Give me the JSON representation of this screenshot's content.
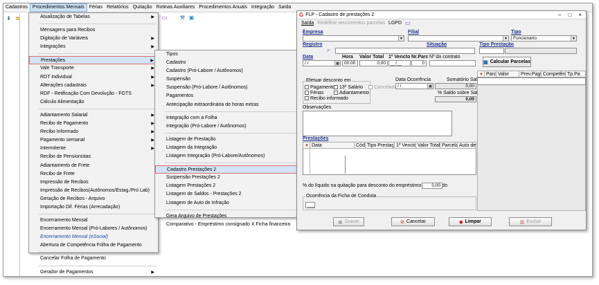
{
  "menubar": [
    "Cadastros",
    "Procedimentos Mensais",
    "Férias",
    "Relatórios",
    "Quitação",
    "Rotinas Auxiliares",
    "Procedimentos Anuais",
    "Integração",
    "Saída"
  ],
  "menu1": [
    {
      "label": "Atualização de Tabelas",
      "arrow": true
    },
    {
      "sep": true
    },
    {
      "label": "Mensagens para Recibos"
    },
    {
      "label": "Digitação de Variáveis",
      "arrow": true
    },
    {
      "label": "Integrações",
      "arrow": true
    },
    {
      "sep": true
    },
    {
      "label": "Prestações",
      "arrow": true,
      "selected": true
    },
    {
      "label": "Vale Transporte",
      "arrow": true
    },
    {
      "label": "RDT Individual",
      "arrow": true
    },
    {
      "label": "Alterações cadastrais",
      "arrow": true
    },
    {
      "label": "RDF - Retificação Com Devolução - FGTS"
    },
    {
      "label": "Cálculo Alimentação"
    },
    {
      "sep": true
    },
    {
      "label": "Adiantamento Salarial",
      "arrow": true
    },
    {
      "label": "Recibo de Pagamento",
      "arrow": true
    },
    {
      "label": "Recibo Informado",
      "arrow": true
    },
    {
      "label": "Pagamento semanal",
      "arrow": true
    },
    {
      "label": "Intermitente",
      "arrow": true
    },
    {
      "label": "Recibo de Pensionistas"
    },
    {
      "label": "Adiantamento de Frete"
    },
    {
      "label": "Recibo de Frete"
    },
    {
      "label": "Impressão de Recibos"
    },
    {
      "label": "Impressão de Recibos(Autônomos/Estag./Pró Lab)"
    },
    {
      "label": "Geração de Recibos - Arquivo"
    },
    {
      "label": "Importação Dif. Férias (Arrecadação)"
    },
    {
      "sep": true
    },
    {
      "label": "Encerramento Mensal"
    },
    {
      "label": "Encerramento Mensal (Pró-Labores / Autônomos)"
    },
    {
      "label": "Encerramento Mensal (eSocial)",
      "blue": true
    },
    {
      "label": "Abertura de Competência Folha de Pagamento"
    },
    {
      "sep": true
    },
    {
      "label": "Cancelar Folha de Pagamento"
    },
    {
      "sep": true
    },
    {
      "label": "Gerador de Pagamentos",
      "arrow": true
    }
  ],
  "menu2": [
    {
      "label": "Tipos"
    },
    {
      "label": "Cadastro"
    },
    {
      "label": "Cadastro (Pró-Labore / Autônomos)"
    },
    {
      "label": "Suspensão"
    },
    {
      "label": "Suspensão (Pró-Labore / Autônomos)"
    },
    {
      "label": "Pagamentos"
    },
    {
      "label": "Antecipação extraordinária de horas extras"
    },
    {
      "sep": true
    },
    {
      "label": "Integração com a Folha"
    },
    {
      "label": "Integração (Pró-Labore / Autônomos)"
    },
    {
      "sep": true
    },
    {
      "label": "Listagem de Prestação"
    },
    {
      "label": "Listagem da Integração"
    },
    {
      "label": "Listagem Integração (Pró-Labore/Autônomos)"
    },
    {
      "sep": true
    },
    {
      "label": "Cadastro Prestações 2",
      "selected": true
    },
    {
      "label": "Suspensão Prestações 2"
    },
    {
      "label": "Listagem Prestações 2"
    },
    {
      "label": "Listagem de Saldos - Prestações 2"
    },
    {
      "label": "Listagem de Auto de Infração"
    },
    {
      "sep": true
    },
    {
      "label": "Gera Arquivo de Prestações"
    },
    {
      "label": "Comparativo - Empréstimo consignado X Ficha financeira"
    }
  ],
  "dialog": {
    "title": "FLP - Cadastro de prestações 2",
    "menu": [
      "Saída",
      "Redefine vencimentos parcelas",
      "LGPD"
    ],
    "empresa": "Empresa",
    "filial": "Filial",
    "tipo": "Tipo",
    "tipo_value": "Funcionário",
    "registro": "Registro",
    "situacao": "Situação",
    "tipo_prestacao": "Tipo Prestação",
    "data": "Data",
    "hora": "Hora",
    "valor_total": "Valor Total",
    "venc1": "1º Vencto",
    "nr_parc": "Nr.Parc",
    "contrato": "Nº do contrato",
    "data_value": "/ /",
    "hora_value": "00:00",
    "valor_value": "0,00",
    "venc_value": "__/__",
    "parc_value": "0",
    "calc_parcelas": "Calcular Parcelas",
    "efetuar": "Efetuar desconto em",
    "checks": [
      "Pagamento",
      "13º Salário",
      "Férias",
      "Adiantamento",
      "Recibo informado"
    ],
    "cancelado": "Cancelado",
    "data_ocorrencia": "Data Ocorrência",
    "data_oc_value": "/ /",
    "somatorio": "Somatório Saldo",
    "somatorio_value": "0,00",
    "pct_saldo": "% Saldo sobre Saldo",
    "pct_saldo_value": "0,00",
    "observacoes": "Observações",
    "prestacoes": "Prestações",
    "grid_cols": [
      "Data",
      "Cód",
      "Tipo Prestação",
      "1º Vencto",
      "Valor Total",
      "Parcelas",
      "Auto de i"
    ],
    "right_cols": [
      "Parc",
      "Valor",
      "Prev.Pagto",
      "Competência",
      "Tp.Pa"
    ],
    "pct_liquido": "% do líquido na quitação para desconto do empréstimo consignado",
    "pct_liquido_value": "0,00",
    "ocorrencia": "Ocorrência da Ficha de Conduta",
    "ocorrencia_value": "___",
    "buttons": [
      "Gravar",
      "Cancelar",
      "Limpar",
      "Excluir"
    ]
  },
  "colors": {
    "menu_sel": "#d2e4f6",
    "accent_red": "#e06a6a",
    "title_link": "#1b2f8a"
  }
}
